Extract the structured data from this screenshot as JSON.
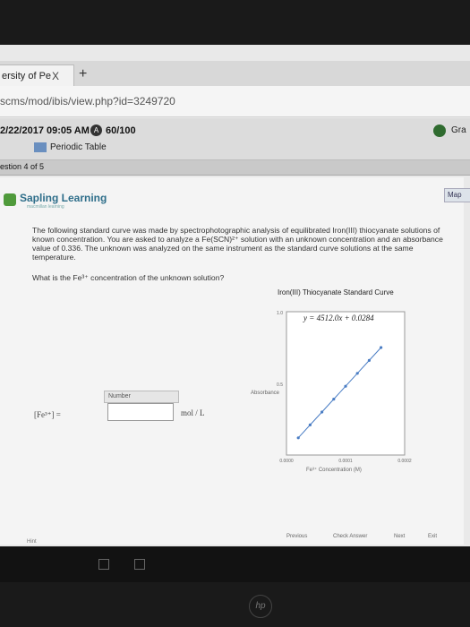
{
  "browser": {
    "tab_title": "ersity of Pe",
    "tab_close": "X",
    "new_tab": "+",
    "url": "scms/mod/ibis/view.php?id=3249720"
  },
  "assignment": {
    "datetime": "2/22/2017 09:05 AM",
    "score": "60/100",
    "grade_label": "Gra",
    "periodic_table": "Periodic Table",
    "question_counter": "estion 4 of 5"
  },
  "sapling": {
    "logo": "Sapling Learning",
    "logo_sub": "macmillan learning",
    "map_button": "Map"
  },
  "question": {
    "intro": "The following standard curve was made by spectrophotographic analysis of equilibrated Iron(III) thiocyanate solutions of known concentration. You are asked to analyze a Fe(SCN)²⁺ solution with an unknown concentration and an absorbance value of 0.336. The unknown was analyzed on the same instrument as the standard curve solutions at the same temperature.",
    "prompt": "What is the Fe³⁺ concentration of the unknown solution?"
  },
  "answer": {
    "number_label": "Number",
    "fe_label": "[Fe³⁺] =",
    "unit": "mol / L"
  },
  "chart_data": {
    "type": "line",
    "title": "Iron(III) Thiocyanate Standard Curve",
    "equation": "y = 4512.0x + 0.0284",
    "xlabel": "Fe³⁺ Concentration (M)",
    "ylabel": "Absorbance",
    "ytick_top": "1.0",
    "ytick_mid": "0.5",
    "xtick_left": "0.0000",
    "xtick_mid": "0.0001",
    "xtick_right": "0.0002",
    "xlim": [
      0,
      0.0002
    ],
    "ylim": [
      0,
      1.0
    ],
    "series": [
      {
        "x": [
          2e-05,
          4e-05,
          6e-05,
          8e-05,
          0.0001,
          0.00012,
          0.00014,
          0.00016
        ],
        "y": [
          0.12,
          0.21,
          0.3,
          0.39,
          0.48,
          0.57,
          0.66,
          0.75
        ]
      }
    ]
  },
  "buttons": {
    "previous": "Previous",
    "check": "Check Answer",
    "next": "Next",
    "exit": "Exit",
    "hint": "Hint"
  }
}
